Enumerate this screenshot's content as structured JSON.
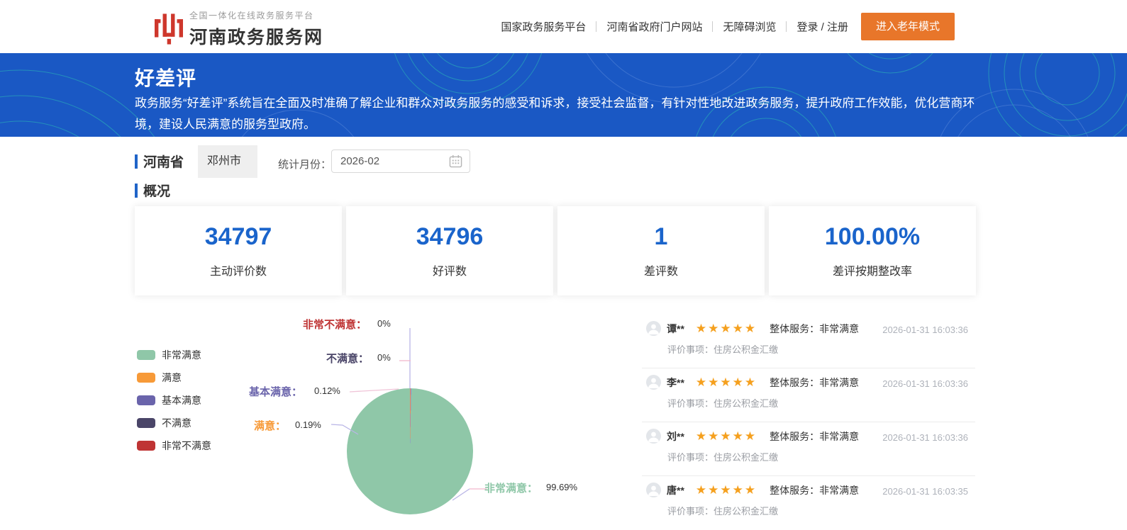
{
  "header": {
    "logo": {
      "subtitle": "全国一体化在线政务服务平台",
      "title": "河南政务服务网"
    },
    "nav": [
      {
        "label": "国家政务服务平台"
      },
      {
        "label": "河南省政府门户网站"
      },
      {
        "label": "无障碍浏览"
      },
      {
        "label": "登录 / 注册"
      }
    ],
    "elder_button": "进入老年模式"
  },
  "banner": {
    "title": "好差评",
    "description": "政务服务“好差评”系统旨在全面及时准确了解企业和群众对政务服务的感受和诉求，接受社会监督，有针对性地改进政务服务，提升政府工作效能，优化营商环境，建设人民满意的服务型政府。"
  },
  "filters": {
    "province": "河南省",
    "city": "邓州市",
    "month_label": "统计月份：",
    "month_value": "2026-02"
  },
  "overview": {
    "section_title": "概况",
    "stats": [
      {
        "value": "34797",
        "label": "主动评价数"
      },
      {
        "value": "34796",
        "label": "好评数"
      },
      {
        "value": "1",
        "label": "差评数"
      },
      {
        "value": "100.00%",
        "label": "差评按期整改率"
      }
    ]
  },
  "chart_data": {
    "type": "pie",
    "categories": [
      "非常满意",
      "满意",
      "基本满意",
      "不满意",
      "非常不满意"
    ],
    "values": [
      99.69,
      0.19,
      0.12,
      0,
      0
    ],
    "unit": "%",
    "colors": [
      "#8fc7a8",
      "#f79a38",
      "#6a64ab",
      "#4a4568",
      "#bf3434"
    ],
    "legend_position": "left",
    "labels": [
      {
        "name": "非常不满意：",
        "value": "0%"
      },
      {
        "name": "不满意：",
        "value": "0%"
      },
      {
        "name": "基本满意：",
        "value": "0.12%"
      },
      {
        "name": "满意：",
        "value": "0.19%"
      },
      {
        "name": "非常满意：",
        "value": "99.69%"
      }
    ]
  },
  "reviews": [
    {
      "name": "谭**",
      "stars": "★★★★★",
      "overall": "整体服务：非常满意",
      "time": "2026-01-31 16:03:36",
      "item": "评价事项：住房公积金汇缴"
    },
    {
      "name": "李**",
      "stars": "★★★★★",
      "overall": "整体服务：非常满意",
      "time": "2026-01-31 16:03:36",
      "item": "评价事项：住房公积金汇缴"
    },
    {
      "name": "刘**",
      "stars": "★★★★★",
      "overall": "整体服务：非常满意",
      "time": "2026-01-31 16:03:36",
      "item": "评价事项：住房公积金汇缴"
    },
    {
      "name": "唐**",
      "stars": "★★★★★",
      "overall": "整体服务：非常满意",
      "time": "2026-01-31 16:03:35",
      "item": "评价事项：住房公积金汇缴"
    }
  ],
  "colors": {
    "banner_blue": "#1a58c4",
    "accent_blue": "#1a64cb",
    "elder_orange": "#e8762a",
    "star_gold": "#f5a01e",
    "logo_red": "#ce372c"
  }
}
